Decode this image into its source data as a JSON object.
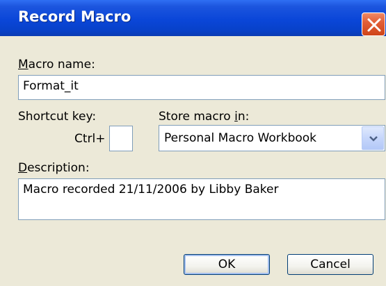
{
  "window": {
    "title": "Record Macro"
  },
  "macro_name": {
    "label_underlined": "M",
    "label_rest": "acro name:",
    "value": "Format_it"
  },
  "shortcut": {
    "label": "Shortcut key:",
    "ctrl_prefix": "Ctrl+",
    "value": ""
  },
  "store": {
    "label_before": "Store macro ",
    "label_underlined": "i",
    "label_after": "n:",
    "selected": "Personal Macro Workbook"
  },
  "description": {
    "label_underlined": "D",
    "label_rest": "escription:",
    "value": "Macro recorded 21/11/2006 by Libby Baker"
  },
  "buttons": {
    "ok": "OK",
    "cancel": "Cancel"
  },
  "icons": {
    "close": "close-icon",
    "dropdown": "chevron-down-icon"
  },
  "colors": {
    "titlebar": "#0a46d8",
    "dialog_bg": "#ece9d8",
    "close_bg": "#e25f37"
  }
}
